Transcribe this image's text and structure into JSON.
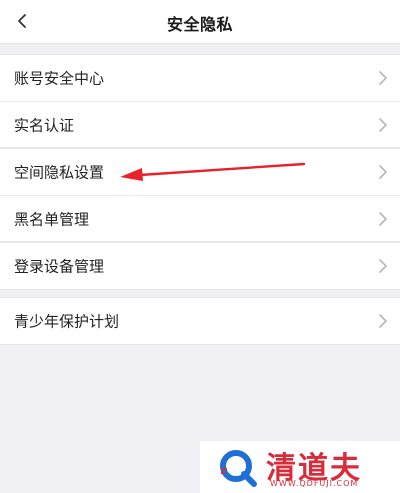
{
  "header": {
    "title": "安全隐私"
  },
  "groups": [
    {
      "items": [
        "账号安全中心",
        "实名认证"
      ]
    },
    {
      "items": [
        "空间隐私设置",
        "黑名单管理"
      ]
    },
    {
      "items": [
        "登录设备管理"
      ]
    },
    {
      "items": [
        "青少年保护计划"
      ]
    }
  ],
  "annotation": {
    "color": "#e8222a",
    "points_to": "空间隐私设置"
  },
  "watermark": {
    "name": "清道夫",
    "url": "WWW.QDFUJI.COM",
    "color": "#d92b3a"
  }
}
